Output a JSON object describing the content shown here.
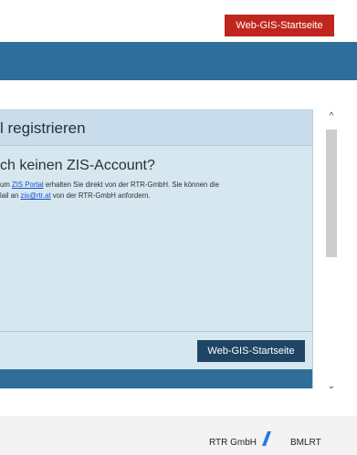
{
  "top": {
    "startseite_button": "Web-GIS-Startseite"
  },
  "modal": {
    "title": "l registrieren",
    "heading": "ch keinen ZIS-Account?",
    "text_line1_prefix": "um ",
    "text_line1_link": "ZIS Portal",
    "text_line1_suffix": " erhalten Sie direkt von der RTR-GmbH. Sie können die",
    "text_line2_prefix": "lail an ",
    "text_line2_link": "zis@rtr.at",
    "text_line2_suffix": " von der RTR-GmbH anfordern.",
    "button": "Web-GIS-Startseite"
  },
  "footer": {
    "left": "RTR GmbH",
    "right": "BMLRT",
    "separator_color": "#1f7be8"
  },
  "colors": {
    "accent_red": "#c0261e",
    "band_blue": "#2f6e9a",
    "modal_button": "#204564"
  }
}
